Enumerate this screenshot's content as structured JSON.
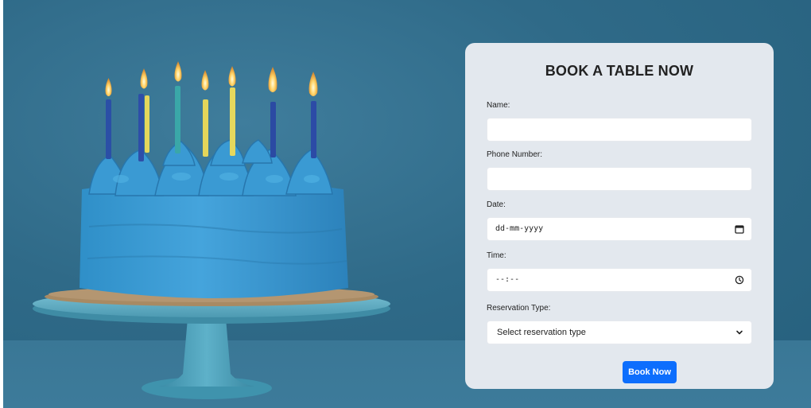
{
  "form": {
    "title": "BOOK A TABLE NOW",
    "name_label": "Name:",
    "name_value": "",
    "phone_label": "Phone Number:",
    "phone_value": "",
    "date_label": "Date:",
    "date_placeholder": "dd-mm-yyyy",
    "time_label": "Time:",
    "time_placeholder": "--:--",
    "type_label": "Reservation Type:",
    "type_selected": "Select reservation type",
    "submit_label": "Book Now"
  },
  "colors": {
    "card_background": "#e3e8ee",
    "button_blue": "#0d6efd",
    "background_blue": "#2f6a88",
    "frosting_blue": "#3a9ad3"
  },
  "icons": {
    "date": "calendar-icon",
    "time": "clock-icon",
    "select": "chevron-down-icon"
  }
}
